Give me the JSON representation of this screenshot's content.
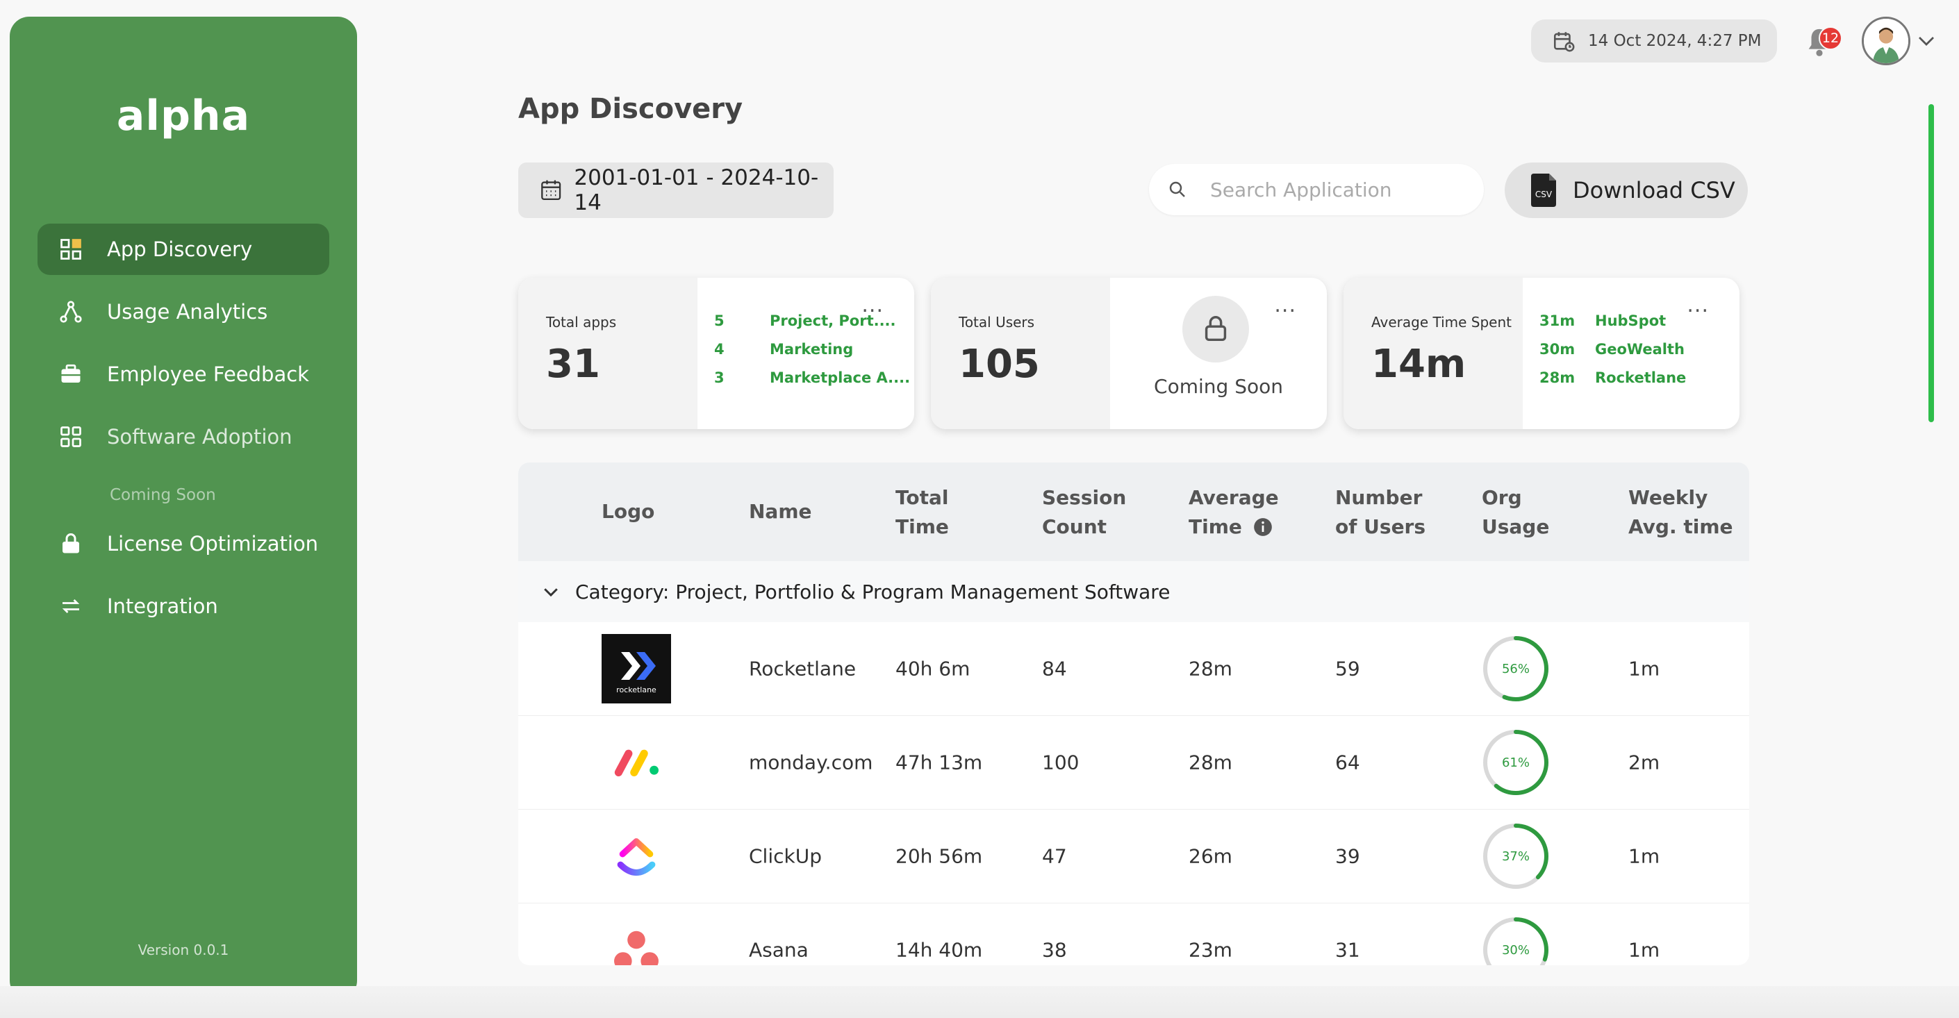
{
  "sidebar": {
    "brand": "alpha",
    "items": [
      {
        "label": "App Discovery",
        "icon": "grid-icon",
        "active": true
      },
      {
        "label": "Usage Analytics",
        "icon": "nodes-icon"
      },
      {
        "label": "Employee Feedback",
        "icon": "briefcase-icon"
      },
      {
        "label": "Software Adoption",
        "icon": "grid-icon",
        "sub": "Coming Soon"
      },
      {
        "label": "License Optimization",
        "icon": "lock-icon"
      },
      {
        "label": "Integration",
        "icon": "sync-icon"
      }
    ],
    "version": "Version 0.0.1"
  },
  "topbar": {
    "datetime": "14 Oct 2024, 4:27 PM",
    "notifications": "12"
  },
  "page": {
    "title": "App Discovery",
    "date_range": "2001-01-01 - 2024-10-14",
    "search_placeholder": "Search Application",
    "download_label": "Download CSV",
    "csv_icon_text": "CSV"
  },
  "cards": {
    "apps": {
      "label": "Total apps",
      "value": "31",
      "rows": [
        {
          "n": "5",
          "name": "Project, Port...."
        },
        {
          "n": "4",
          "name": "Marketing"
        },
        {
          "n": "3",
          "name": "Marketplace A...."
        }
      ]
    },
    "users": {
      "label": "Total Users",
      "value": "105",
      "soon": "Coming Soon"
    },
    "time": {
      "label": "Average Time Spent",
      "value": "14m",
      "rows": [
        {
          "n": "31m",
          "name": "HubSpot"
        },
        {
          "n": "30m",
          "name": "GeoWealth"
        },
        {
          "n": "28m",
          "name": "Rocketlane"
        }
      ]
    },
    "menu": "..."
  },
  "table": {
    "headers": {
      "logo": "Logo",
      "name": "Name",
      "total_time_1": "Total",
      "total_time_2": "Time",
      "session_1": "Session",
      "session_2": "Count",
      "avg_1": "Average",
      "avg_2": "Time",
      "users_1": "Number",
      "users_2": "of Users",
      "org_1": "Org",
      "org_2": "Usage",
      "weekly_1": "Weekly",
      "weekly_2": "Avg. time"
    },
    "category": "Category: Project, Portfolio & Program Management Software",
    "rows": [
      {
        "name": "Rocketlane",
        "total": "40h 6m",
        "sessions": "84",
        "avg": "28m",
        "users": "59",
        "org": "56%",
        "org_pct": 56,
        "weekly": "1m",
        "logo_text": "rocketlane"
      },
      {
        "name": "monday.com",
        "total": "47h 13m",
        "sessions": "100",
        "avg": "28m",
        "users": "64",
        "org": "61%",
        "org_pct": 61,
        "weekly": "2m"
      },
      {
        "name": "ClickUp",
        "total": "20h 56m",
        "sessions": "47",
        "avg": "26m",
        "users": "39",
        "org": "37%",
        "org_pct": 37,
        "weekly": "1m"
      },
      {
        "name": "Asana",
        "total": "14h 40m",
        "sessions": "38",
        "avg": "23m",
        "users": "31",
        "org": "30%",
        "org_pct": 30,
        "weekly": "1m"
      }
    ]
  },
  "colors": {
    "sidebar": "#519450",
    "active": "#3b733b",
    "accent": "#2e9a3f",
    "ring_bg": "#d9d9d9"
  }
}
